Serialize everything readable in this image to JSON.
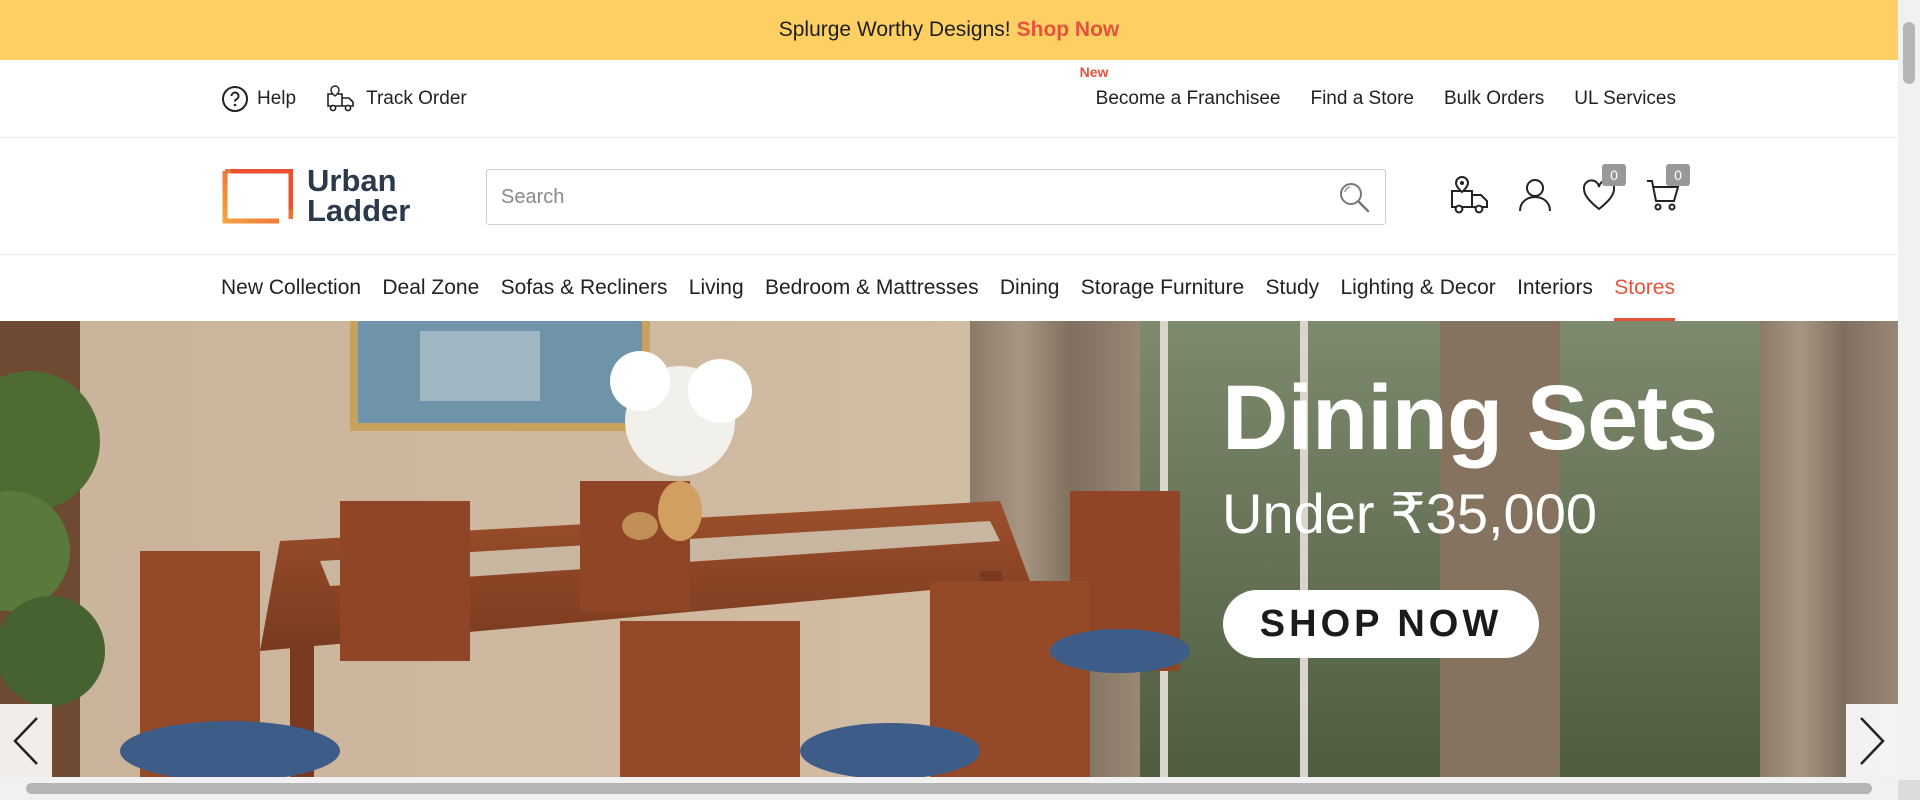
{
  "announcement": {
    "text": "Splurge Worthy Designs!",
    "cta": "Shop Now"
  },
  "utility": {
    "help": "Help",
    "track_order": "Track Order",
    "new_tag": "New",
    "links": [
      "Become a Franchisee",
      "Find a Store",
      "Bulk Orders",
      "UL Services"
    ]
  },
  "logo": {
    "line1": "Urban",
    "line2": "Ladder"
  },
  "search": {
    "placeholder": "Search"
  },
  "header_icons": {
    "wishlist_count": "0",
    "cart_count": "0"
  },
  "nav": {
    "items": [
      "New Collection",
      "Deal Zone",
      "Sofas & Recliners",
      "Living",
      "Bedroom & Mattresses",
      "Dining",
      "Storage Furniture",
      "Study",
      "Lighting & Decor",
      "Interiors",
      "Stores"
    ],
    "active": "Stores"
  },
  "hero": {
    "title": "Dining Sets",
    "subtitle": "Under ₹35,000",
    "button": "SHOP NOW"
  },
  "colors": {
    "announcement_bg": "#fed063",
    "accent": "#e5533d",
    "logo_text": "#2b3a4a"
  }
}
